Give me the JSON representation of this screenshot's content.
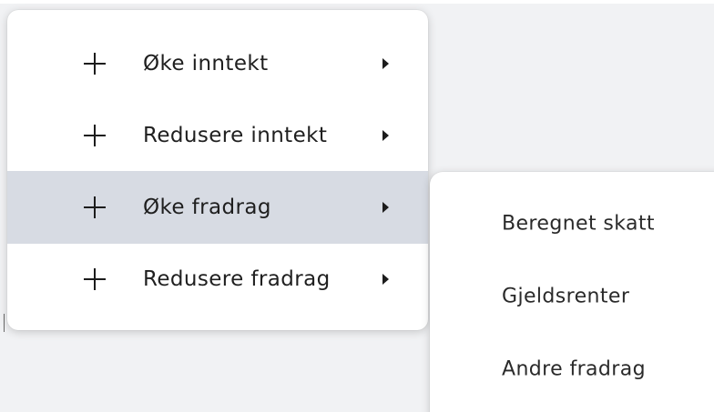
{
  "menu": {
    "items": [
      {
        "label": "Øke inntekt",
        "active": false
      },
      {
        "label": "Redusere inntekt",
        "active": false
      },
      {
        "label": "Øke fradrag",
        "active": true
      },
      {
        "label": "Redusere fradrag",
        "active": false
      }
    ]
  },
  "submenu": {
    "items": [
      {
        "label": "Beregnet skatt"
      },
      {
        "label": "Gjeldsrenter"
      },
      {
        "label": "Andre fradrag"
      }
    ]
  },
  "colors": {
    "active_bg": "#d7dbe3",
    "menu_bg": "#ffffff",
    "text": "#1f1f1f"
  },
  "icons": {
    "add": "plus-icon",
    "submenu_indicator": "caret-right-icon"
  }
}
